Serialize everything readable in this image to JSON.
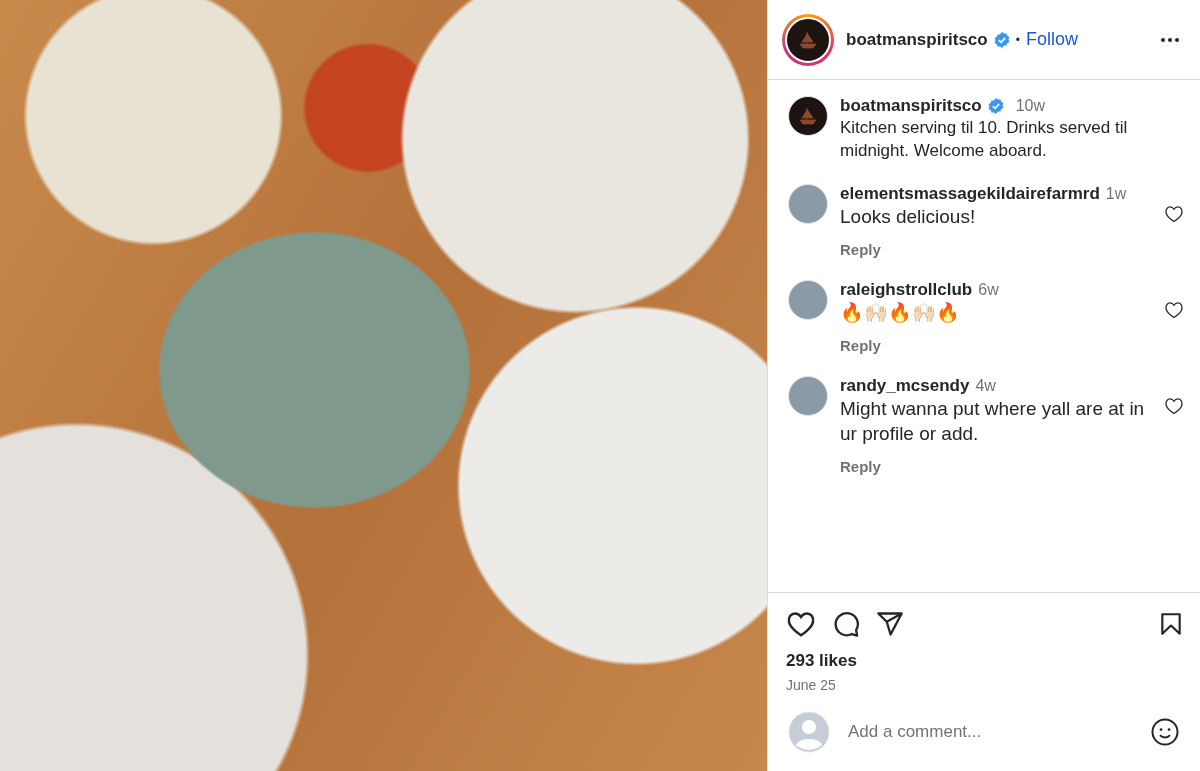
{
  "header": {
    "username": "boatmanspiritsco",
    "verified": true,
    "separator": "•",
    "follow": "Follow"
  },
  "caption": {
    "username": "boatmanspiritsco",
    "verified": true,
    "time": "10w",
    "text": "Kitchen serving til 10. Drinks served til midnight. Welcome aboard."
  },
  "comments": [
    {
      "username": "elementsmassagekildairefarmrd",
      "time": "1w",
      "text": "Looks delicious!",
      "reply": "Reply",
      "liked": false
    },
    {
      "username": "raleighstrollclub",
      "time": "6w",
      "text": "🔥🙌🏻🔥🙌🏻🔥",
      "reply": "Reply",
      "liked": false
    },
    {
      "username": "randy_mcsendy",
      "time": "4w",
      "text": "Might wanna put where yall are at in ur profile or add.",
      "reply": "Reply",
      "liked": false
    }
  ],
  "actions": {
    "likes": "293 likes",
    "date": "June 25",
    "saved": false,
    "liked": false
  },
  "comment_box": {
    "placeholder": "Add a comment..."
  }
}
